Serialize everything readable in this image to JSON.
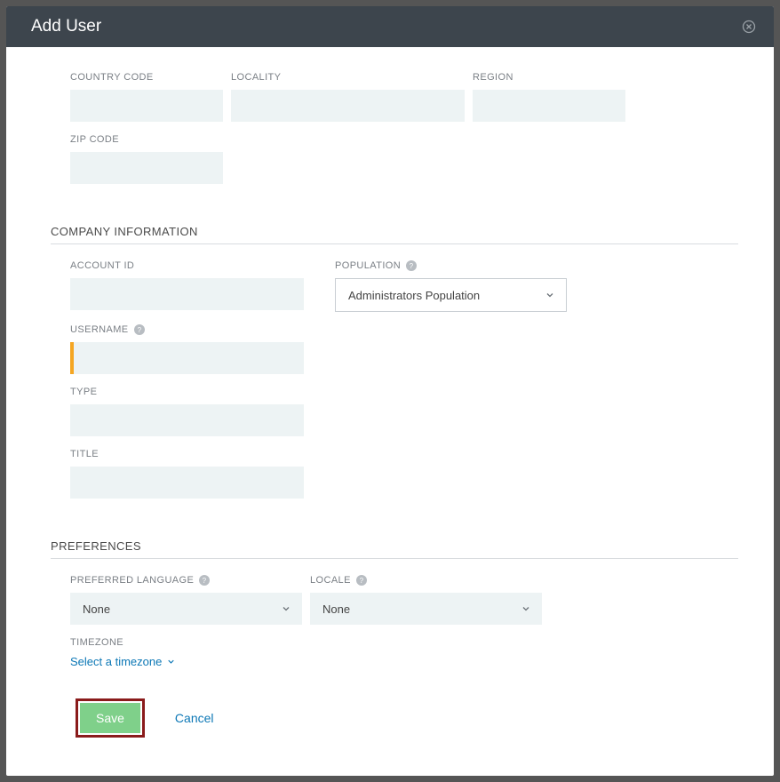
{
  "header": {
    "title": "Add User"
  },
  "address": {
    "country_code_label": "COUNTRY CODE",
    "locality_label": "LOCALITY",
    "region_label": "REGION",
    "zip_label": "ZIP CODE",
    "country_code": "",
    "locality": "",
    "region": "",
    "zip": ""
  },
  "company": {
    "section_title": "COMPANY INFORMATION",
    "account_id_label": "ACCOUNT ID",
    "account_id": "",
    "population_label": "POPULATION",
    "population_selected": "Administrators Population",
    "username_label": "USERNAME",
    "username": "",
    "type_label": "TYPE",
    "type": "",
    "title_label": "TITLE",
    "title": ""
  },
  "preferences": {
    "section_title": "PREFERENCES",
    "preferred_language_label": "PREFERRED LANGUAGE",
    "preferred_language": "None",
    "locale_label": "LOCALE",
    "locale": "None",
    "timezone_label": "TIMEZONE",
    "timezone_link": "Select a timezone"
  },
  "actions": {
    "save": "Save",
    "cancel": "Cancel"
  }
}
